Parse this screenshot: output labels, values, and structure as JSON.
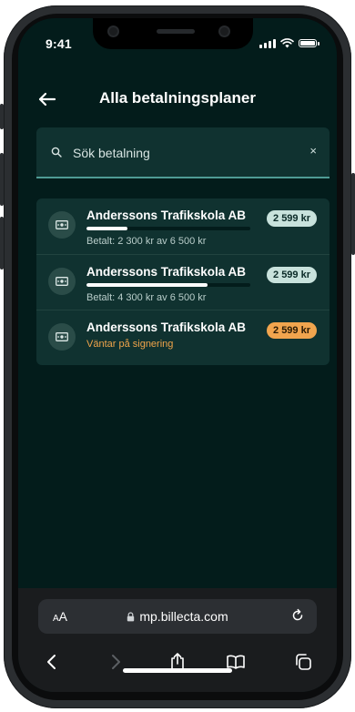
{
  "status_bar": {
    "time": "9:41"
  },
  "header": {
    "title": "Alla betalningsplaner"
  },
  "search": {
    "placeholder": "Sök betalning",
    "clear_label": "×"
  },
  "payments": [
    {
      "title": "Anderssons Trafikskola AB",
      "amount": "2 599 kr",
      "progress": 0.25,
      "status": "Betalt: 2 300 kr av 6 500 kr",
      "state": "paying"
    },
    {
      "title": "Anderssons Trafikskola AB",
      "amount": "2 599 kr",
      "progress": 0.74,
      "status": "Betalt: 4 300 kr av 6 500 kr",
      "state": "paying"
    },
    {
      "title": "Anderssons Trafikskola AB",
      "amount": "2 599 kr",
      "progress": null,
      "status": "Väntar på signering",
      "state": "pending"
    }
  ],
  "browser": {
    "text_size_label": "AA",
    "url": "mp.billecta.com"
  },
  "colors": {
    "background": "#031c1b",
    "card": "#103230",
    "accent": "#4f9b94",
    "pending": "#f0a44a",
    "badge": "#c8e2dc",
    "badge_warn": "#f1a54e"
  }
}
